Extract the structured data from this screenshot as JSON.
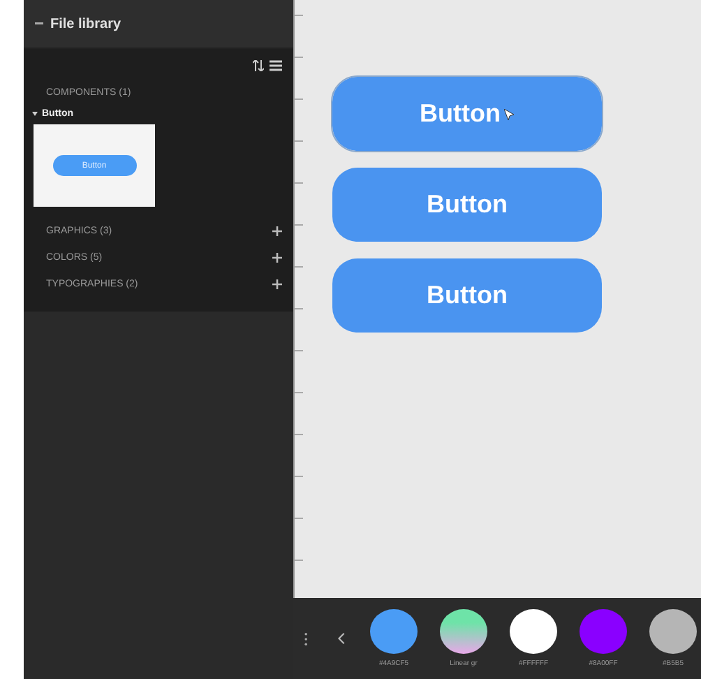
{
  "library": {
    "title": "File library",
    "sections": [
      {
        "label": "COMPONENTS (1)",
        "addable": false,
        "groups": [
          {
            "label": "Button",
            "items": [
              {
                "label": "Button"
              }
            ]
          }
        ]
      },
      {
        "label": "GRAPHICS (3)",
        "addable": true
      },
      {
        "label": "COLORS (5)",
        "addable": true
      },
      {
        "label": "TYPOGRAPHIES (2)",
        "addable": true
      }
    ]
  },
  "canvas": {
    "buttons": [
      {
        "label": "Button",
        "selected": true
      },
      {
        "label": "Button",
        "selected": false
      },
      {
        "label": "Button",
        "selected": false
      }
    ]
  },
  "palette": {
    "swatches": [
      {
        "kind": "solid",
        "color": "#4a9cf5",
        "label": "#4A9CF5"
      },
      {
        "kind": "gradient",
        "color": "#6ee3a8",
        "label": "Linear gr"
      },
      {
        "kind": "solid",
        "color": "#ffffff",
        "label": "#FFFFFF"
      },
      {
        "kind": "solid",
        "color": "#8a00ff",
        "label": "#8A00FF"
      },
      {
        "kind": "solid",
        "color": "#b5b5b5",
        "label": "#B5B5"
      }
    ]
  }
}
